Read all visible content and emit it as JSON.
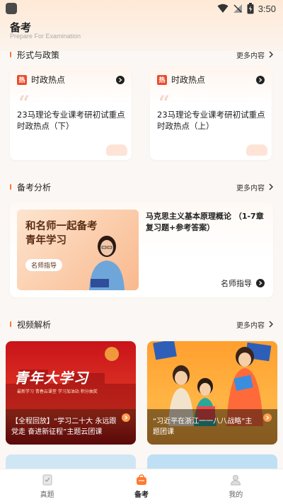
{
  "status_bar": {
    "time": "3:50"
  },
  "header": {
    "title": "备考",
    "subtitle": "Prepare For Examination"
  },
  "policy_section": {
    "title": "形式与政策",
    "more": "更多内容",
    "cards": [
      {
        "badge": "热",
        "category": "时政热点",
        "quote": "“",
        "text": "23马理论专业课考研初试重点时政热点（下）"
      },
      {
        "badge": "热",
        "category": "时政热点",
        "quote": "“",
        "text": "23马理论专业课考研初试重点时政热点（上）"
      }
    ]
  },
  "analysis_section": {
    "title": "备考分析",
    "more": "更多内容",
    "banner_title_line1": "和名师一起备考",
    "banner_title_line2": "青年学习",
    "banner_pill": "名师指导",
    "headline": "马克思主义基本原理概论 （1-7章复习题+参考答案）",
    "cta": "名师指导"
  },
  "video_section": {
    "title": "视频解析",
    "more": "更多内容",
    "cards": [
      {
        "banner": "青年大学习",
        "banner_sub": "最新学习 青春云课堂 学习加油站 积分抽奖",
        "text": "【全程回放】“学习二十大 永远跟党走 奋进新征程”主题云团课"
      },
      {
        "text": "“习近平在浙江一一八八战略”主题团课"
      }
    ]
  },
  "tabbar": {
    "tabs": [
      {
        "label": "真题",
        "icon": "exam-paper-icon",
        "active": false
      },
      {
        "label": "备考",
        "icon": "bag-icon",
        "active": true
      },
      {
        "label": "我的",
        "icon": "profile-icon",
        "active": false
      }
    ]
  },
  "colors": {
    "accent": "#ff7a2e",
    "hot_badge": "#e94c2b",
    "tab_active": "#ff7a2e"
  }
}
